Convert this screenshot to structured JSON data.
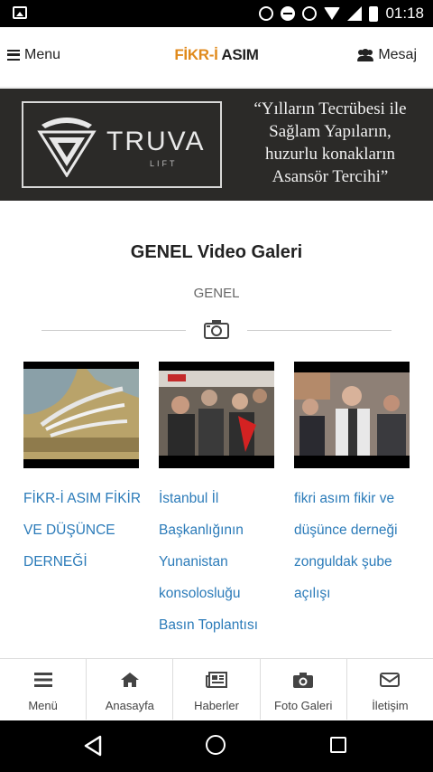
{
  "status_bar": {
    "time": "01:18"
  },
  "header": {
    "menu_label": "Menu",
    "logo_part1": "FİKR-İ",
    "logo_part2": "ASIM",
    "message_label": "Mesaj"
  },
  "banner": {
    "brand": "TRUVA",
    "brand_sub": "LIFT",
    "quote_lines": [
      "“Yılların Tecrübesi ile",
      "Sağlam Yapıların,",
      "huzurlu konakların",
      "Asansör Tercihi”"
    ]
  },
  "section": {
    "title": "GENEL Video Galeri",
    "category": "GENEL",
    "icon": "camera-icon"
  },
  "videos": [
    {
      "title": "FİKR-İ ASIM FİKİR VE DÜŞÜNCE DERNEĞİ",
      "caption_lines": [
        "FİKR-İ ASIM FİKİR",
        "VE DÜŞÜNCE",
        "DERNEĞİ"
      ]
    },
    {
      "title": "İstanbul İl Başkanlığının Yunanistan konsolosluğu Basın Toplantısı",
      "caption_lines": [
        "İstanbul İl",
        "Başkanlığının",
        "Yunanistan",
        "konsolosluğu",
        "Basın Toplantısı"
      ]
    },
    {
      "title": "fikri asım fikir ve düşünce derneği zonguldak şube açılışı",
      "caption_lines": [
        "fikri asım fikir ve",
        "düşünce derneği",
        "zonguldak şube",
        "açılışı"
      ]
    }
  ],
  "bottom_nav": [
    {
      "label": "Menü",
      "icon": "menu-icon"
    },
    {
      "label": "Anasayfa",
      "icon": "home-icon"
    },
    {
      "label": "Haberler",
      "icon": "newspaper-icon"
    },
    {
      "label": "Foto Galeri",
      "icon": "camera-icon"
    },
    {
      "label": "İletişim",
      "icon": "envelope-icon"
    }
  ],
  "colors": {
    "accent": "#e08a1c",
    "link": "#2b7bb9",
    "banner_bg": "#2b2a28"
  }
}
